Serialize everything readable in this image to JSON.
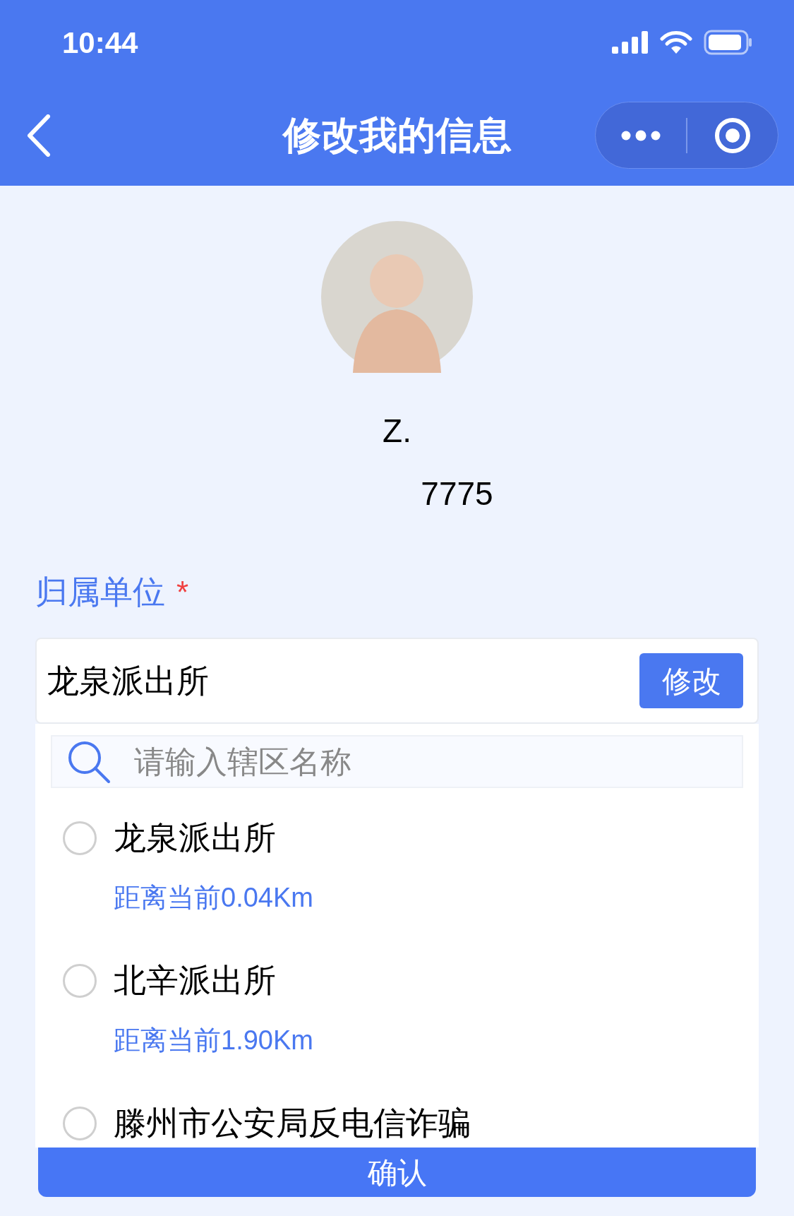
{
  "status_bar": {
    "time": "10:44"
  },
  "nav": {
    "title": "修改我的信息"
  },
  "profile": {
    "name": "Z.",
    "phone": "7775"
  },
  "unit": {
    "label": "归属单位",
    "required_mark": "*",
    "value": "龙泉派出所",
    "edit_button": "修改"
  },
  "search": {
    "placeholder": "请输入辖区名称"
  },
  "options": [
    {
      "name": "龙泉派出所",
      "distance": "距离当前0.04Km",
      "selected": false
    },
    {
      "name": "北辛派出所",
      "distance": "距离当前1.90Km",
      "selected": false
    },
    {
      "name": "滕州市公安局反电信诈骗",
      "selected": false
    }
  ],
  "confirm_button": "确认"
}
